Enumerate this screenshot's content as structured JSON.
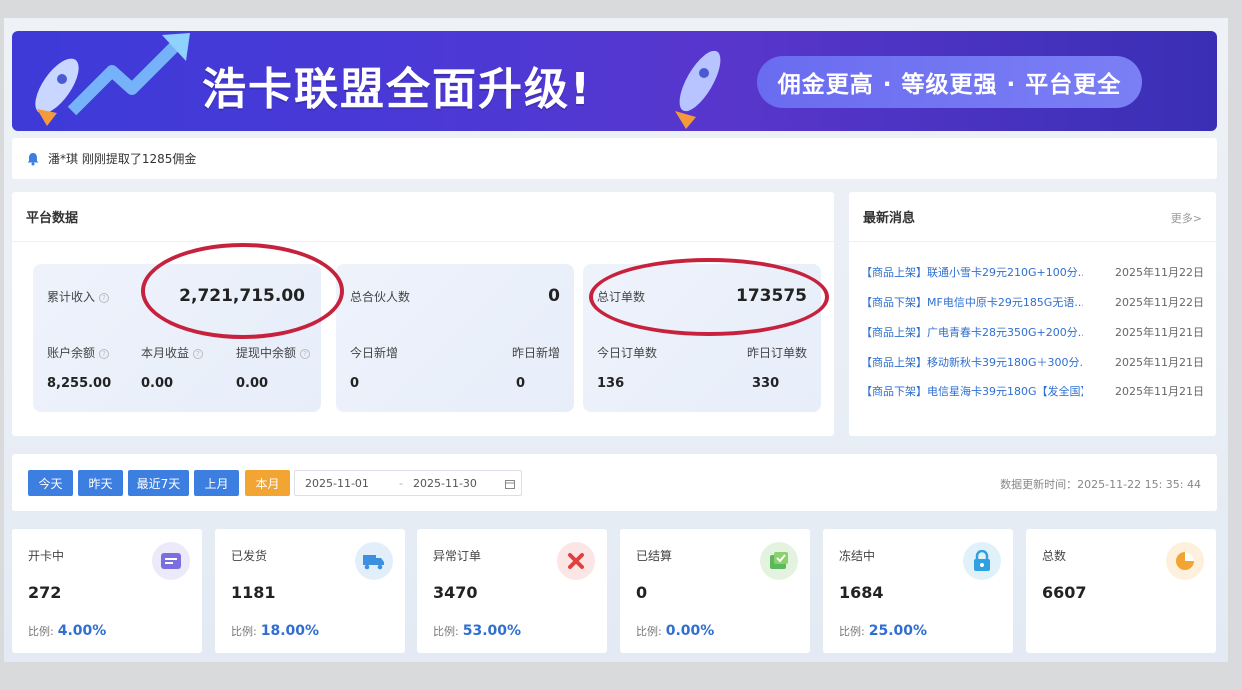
{
  "banner": {
    "title": "浩卡联盟全面升级!",
    "slogan": "佣金更高 · 等级更强 · 平台更全"
  },
  "notice": {
    "text": "潘*琪 刚刚提取了1285佣金"
  },
  "platform": {
    "title": "平台数据",
    "income": {
      "label": "累计收入",
      "value": "2,721,715.00"
    },
    "balance": {
      "label": "账户余额",
      "value": "8,255.00"
    },
    "month_income": {
      "label": "本月收益",
      "value": "0.00"
    },
    "withdrawing": {
      "label": "提现中余额",
      "value": "0.00"
    },
    "partners": {
      "label": "总合伙人数",
      "value": "0"
    },
    "today_new": {
      "label": "今日新增",
      "value": "0"
    },
    "yesterday_new": {
      "label": "昨日新增",
      "value": "0"
    },
    "orders": {
      "label": "总订单数",
      "value": "173575"
    },
    "today_orders": {
      "label": "今日订单数",
      "value": "136"
    },
    "yesterday_orders": {
      "label": "昨日订单数",
      "value": "330"
    }
  },
  "news": {
    "title": "最新消息",
    "more": "更多>",
    "items": [
      {
        "title": "【商品上架】联通小雪卡29元210G+100分...",
        "date": "2025年11月22日"
      },
      {
        "title": "【商品下架】MF电信中原卡29元185G无语...",
        "date": "2025年11月22日"
      },
      {
        "title": "【商品上架】广电青春卡28元350G+200分...",
        "date": "2025年11月21日"
      },
      {
        "title": "【商品上架】移动新秋卡39元180G＋300分...",
        "date": "2025年11月21日"
      },
      {
        "title": "【商品下架】电信星海卡39元180G【发全国】",
        "date": "2025年11月21日"
      }
    ]
  },
  "filter": {
    "buttons": [
      "今天",
      "昨天",
      "最近7天",
      "上月",
      "本月"
    ],
    "active": "本月",
    "start_date": "2025-11-01",
    "separator": "-",
    "end_date": "2025-11-30",
    "update_time": "数据更新时间：2025-11-22 15: 35: 44"
  },
  "stats": [
    {
      "label": "开卡中",
      "value": "272",
      "ratio_label": "比例:",
      "ratio": "4.00%",
      "icon": "card-icon",
      "color": "#7b6fe0"
    },
    {
      "label": "已发货",
      "value": "1181",
      "ratio_label": "比例:",
      "ratio": "18.00%",
      "icon": "truck-icon",
      "color": "#3d8fe0"
    },
    {
      "label": "异常订单",
      "value": "3470",
      "ratio_label": "比例:",
      "ratio": "53.00%",
      "icon": "close-icon",
      "color": "#e04040"
    },
    {
      "label": "已结算",
      "value": "0",
      "ratio_label": "比例:",
      "ratio": "0.00%",
      "icon": "settled-icon",
      "color": "#5cb85c"
    },
    {
      "label": "冻结中",
      "value": "1684",
      "ratio_label": "比例:",
      "ratio": "25.00%",
      "icon": "lock-icon",
      "color": "#2fa0e0"
    },
    {
      "label": "总数",
      "value": "6607",
      "icon": "pie-icon",
      "color": "#f3a533"
    }
  ]
}
